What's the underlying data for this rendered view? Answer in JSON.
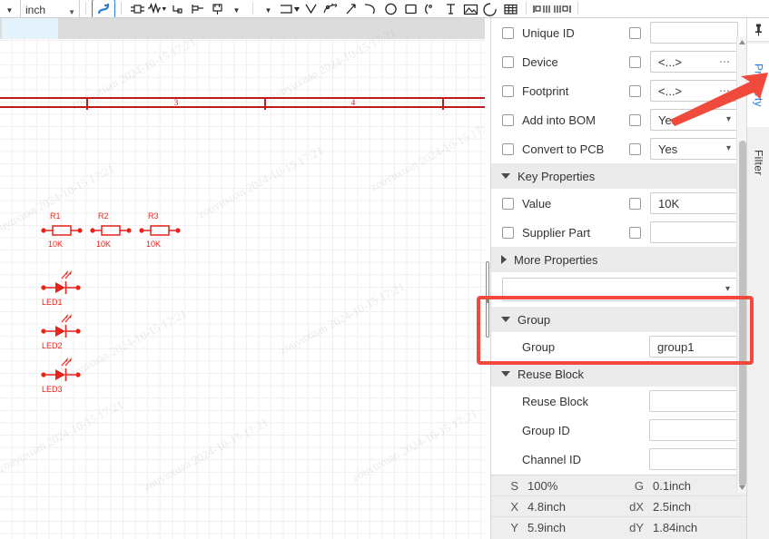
{
  "toolbar": {
    "unit_select": {
      "value": "inch",
      "icon": "chevron-down-icon"
    },
    "left_caret": "caret-down-icon",
    "buttons": [
      {
        "name": "wire-tool",
        "icon": "wire-icon",
        "active": true
      },
      {
        "name": "place-part",
        "icon": "component-icon"
      },
      {
        "name": "place-resistor",
        "icon": "resistor-icon",
        "has_caret": true
      },
      {
        "name": "place-netport",
        "icon": "netport-icon"
      },
      {
        "name": "place-netflag",
        "icon": "netflag-icon"
      },
      {
        "name": "place-bus",
        "icon": "bus-icon"
      },
      {
        "name": "more-parts",
        "icon": "caret-down-icon",
        "has_caret": true
      },
      {
        "name": "shape-menu",
        "icon": "caret-down-icon",
        "has_caret": true
      },
      {
        "name": "place-rect",
        "icon": "rectangle-icon",
        "has_caret": true
      },
      {
        "name": "polyline-tool",
        "icon": "polyline-icon"
      },
      {
        "name": "bezier-tool",
        "icon": "bezier-icon"
      },
      {
        "name": "line-tool",
        "icon": "line-icon"
      },
      {
        "name": "arc-tool",
        "icon": "arc-icon"
      },
      {
        "name": "circle-tool",
        "icon": "circle-icon"
      },
      {
        "name": "ellipse-tool",
        "icon": "ellipse-icon"
      },
      {
        "name": "round-rect-tool",
        "icon": "rounded-rect-icon"
      },
      {
        "name": "pin-tool",
        "icon": "pin-icon"
      },
      {
        "name": "text-tool",
        "icon": "text-icon"
      },
      {
        "name": "image-tool",
        "icon": "image-icon"
      },
      {
        "name": "pie-tool",
        "icon": "pie-icon"
      },
      {
        "name": "table-tool",
        "icon": "table-icon"
      },
      {
        "name": "align-left-tool",
        "icon": "align-left-icon"
      },
      {
        "name": "align-right-tool",
        "icon": "align-right-icon"
      }
    ]
  },
  "canvas": {
    "frame": {
      "numbers": [
        "3",
        "4"
      ],
      "color": "#c01c1c"
    },
    "components": [
      {
        "ref": "R1",
        "value": "10K",
        "type": "resistor"
      },
      {
        "ref": "R2",
        "value": "10K",
        "type": "resistor"
      },
      {
        "ref": "R3",
        "value": "10K",
        "type": "resistor"
      },
      {
        "ref": "LED1",
        "value": "",
        "type": "led"
      },
      {
        "ref": "LED2",
        "value": "",
        "type": "led"
      },
      {
        "ref": "LED3",
        "value": "",
        "type": "led"
      }
    ],
    "symbol_color": "#e8231a",
    "watermark_text": "zouyuxuan 2024-10-15 17:21"
  },
  "panel": {
    "rows": [
      {
        "name": "unique-id",
        "label": "Unique ID",
        "value": "",
        "kind": "text",
        "checked": false,
        "lock": false
      },
      {
        "name": "device",
        "label": "Device",
        "value": "<...>",
        "kind": "text-dots",
        "checked": false,
        "lock": false
      },
      {
        "name": "footprint",
        "label": "Footprint",
        "value": "<...>",
        "kind": "text-dots",
        "checked": false,
        "lock": false
      },
      {
        "name": "add-into-bom",
        "label": "Add into BOM",
        "value": "Yes",
        "kind": "select",
        "checked": false,
        "lock": false
      },
      {
        "name": "convert-to-pcb",
        "label": "Convert to PCB",
        "value": "Yes",
        "kind": "select",
        "checked": false,
        "lock": false
      }
    ],
    "key_properties": {
      "title": "Key Properties",
      "expanded": true,
      "rows": [
        {
          "name": "value",
          "label": "Value",
          "value": "10K",
          "kind": "text",
          "checked": false,
          "lock": false
        },
        {
          "name": "supplier-part",
          "label": "Supplier Part",
          "value": "",
          "kind": "text",
          "checked": false,
          "lock": false
        }
      ]
    },
    "more_properties": {
      "title": "More Properties",
      "expanded": false
    },
    "more_properties_select": {
      "name": "more-properties-select",
      "value": ""
    },
    "group_section": {
      "title": "Group",
      "expanded": true,
      "rows": [
        {
          "name": "group",
          "label": "Group",
          "value": "group1",
          "kind": "select"
        }
      ]
    },
    "reuse_block_section": {
      "title": "Reuse Block",
      "expanded": true,
      "rows": [
        {
          "name": "reuse-block",
          "label": "Reuse Block",
          "value": "",
          "kind": "select"
        },
        {
          "name": "group-id",
          "label": "Group ID",
          "value": "",
          "kind": "text"
        },
        {
          "name": "channel-id",
          "label": "Channel ID",
          "value": "",
          "kind": "text"
        }
      ]
    }
  },
  "status": {
    "rows": [
      {
        "k": "S",
        "v": "100%",
        "k2": "G",
        "v2": "0.1inch"
      },
      {
        "k": "X",
        "v": "4.8inch",
        "k2": "dX",
        "v2": "2.5inch"
      },
      {
        "k": "Y",
        "v": "5.9inch",
        "k2": "dY",
        "v2": "1.84inch"
      }
    ]
  },
  "rail": {
    "pin": "pin-icon",
    "tabs": [
      {
        "name": "property",
        "label": "Property",
        "active": true
      },
      {
        "name": "filter",
        "label": "Filter",
        "active": false
      }
    ]
  },
  "annotation": {
    "arrow_color": "#f04a3c",
    "box_color": "#f04a3c"
  }
}
